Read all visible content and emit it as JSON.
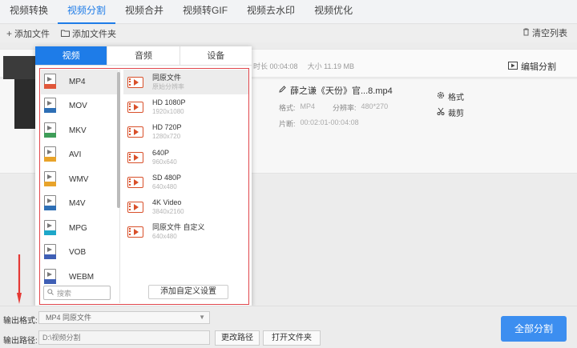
{
  "top_tabs": [
    {
      "label": "视频转换",
      "active": false
    },
    {
      "label": "视频分割",
      "active": true
    },
    {
      "label": "视频合并",
      "active": false
    },
    {
      "label": "视频转GIF",
      "active": false
    },
    {
      "label": "视频去水印",
      "active": false
    },
    {
      "label": "视频优化",
      "active": false
    }
  ],
  "toolbar": {
    "add_file": "添加文件",
    "add_folder": "添加文件夹",
    "clear_list": "清空列表"
  },
  "file_row_head": {
    "duration_label": "时长",
    "duration": "00:04:08",
    "size_label": "大小",
    "size": "11.19 MB",
    "edit_split": "编辑分割"
  },
  "file_row": {
    "name": "薛之谦《天份》官...8.mp4",
    "format_label": "格式:",
    "format": "MP4",
    "resolution_label": "分辨率:",
    "resolution": "480*270",
    "segment_label": "片断:",
    "segment": "00:02:01-00:04:08",
    "action_format": "格式",
    "action_cut": "裁剪"
  },
  "panel": {
    "tabs": [
      {
        "label": "视频",
        "active": true
      },
      {
        "label": "音频",
        "active": false
      },
      {
        "label": "设备",
        "active": false
      }
    ],
    "formats": [
      {
        "label": "MP4",
        "band_color": "#e0573a",
        "selected": true
      },
      {
        "label": "MOV",
        "band_color": "#2e6fb5",
        "selected": false
      },
      {
        "label": "MKV",
        "band_color": "#3e9d58",
        "selected": false
      },
      {
        "label": "AVI",
        "band_color": "#e8a32a",
        "selected": false
      },
      {
        "label": "WMV",
        "band_color": "#e8a32a",
        "selected": false
      },
      {
        "label": "M4V",
        "band_color": "#2e6fb5",
        "selected": false
      },
      {
        "label": "MPG",
        "band_color": "#1ea7c9",
        "selected": false
      },
      {
        "label": "VOB",
        "band_color": "#3f5fb5",
        "selected": false
      },
      {
        "label": "WEBM",
        "band_color": "#3f5fb5",
        "selected": false
      }
    ],
    "resolutions": [
      {
        "title": "同原文件",
        "sub": "原始分辨率",
        "selected": true
      },
      {
        "title": "HD 1080P",
        "sub": "1920x1080",
        "selected": false
      },
      {
        "title": "HD 720P",
        "sub": "1280x720",
        "selected": false
      },
      {
        "title": "640P",
        "sub": "960x640",
        "selected": false
      },
      {
        "title": "SD 480P",
        "sub": "640x480",
        "selected": false
      },
      {
        "title": "4K Video",
        "sub": "3840x2160",
        "selected": false
      },
      {
        "title": "同原文件 自定义",
        "sub": "640x480",
        "selected": false
      }
    ],
    "search_placeholder": "搜索",
    "add_custom": "添加自定义设置"
  },
  "bottom": {
    "output_format_label": "输出格式:",
    "output_format_value": "MP4 同原文件",
    "output_path_label": "输出路径:",
    "output_path_value": "D:\\视频分割",
    "change_path": "更改路径",
    "open_folder": "打开文件夹",
    "split_all": "全部分割"
  },
  "colors": {
    "accent": "#1e7ce8",
    "primary_button": "#3c8ef0",
    "highlight_box": "#e0464c",
    "arrow": "#e53935"
  }
}
